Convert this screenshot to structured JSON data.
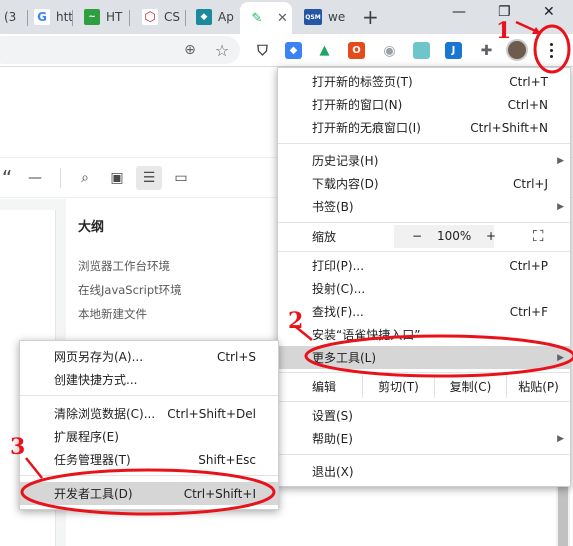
{
  "tabs": [
    {
      "label": "(3",
      "icon": "partial-tab-icon",
      "color": "#ffffff"
    },
    {
      "label": "htt",
      "icon": "google-g-icon",
      "color": "#4285f4"
    },
    {
      "label": "HT",
      "icon": "html-tab-icon",
      "color": "#2e9e3e"
    },
    {
      "label": "CS",
      "icon": "css-tab-icon",
      "color": "#c1272d"
    },
    {
      "label": "Ap",
      "icon": "api-tab-icon",
      "color": "#1a8a9c"
    },
    {
      "label": "",
      "icon": "active-tab-icon",
      "color": "#25b864"
    },
    {
      "label": "we",
      "icon": "qsm-tab-icon",
      "color": "#2456a6",
      "badge": "QSM"
    }
  ],
  "new_tab_symbol": "+",
  "window_controls": {
    "minimize": "—",
    "restore": "❐",
    "close": "✕"
  },
  "extensions": [
    {
      "icon": "shield-ext-icon",
      "glyph": "⛉",
      "color": "#3c4043"
    },
    {
      "icon": "blue-ext-icon",
      "glyph": "◆",
      "color": "#3b82f6"
    },
    {
      "icon": "drive-ext-icon",
      "glyph": "▲",
      "color": "#1fa463"
    },
    {
      "icon": "office-ext-icon",
      "glyph": "O",
      "color": "#e64a19"
    },
    {
      "icon": "camera-ext-icon",
      "glyph": "◉",
      "color": "#9aa0a6"
    },
    {
      "icon": "doc-ext-icon",
      "glyph": "▮",
      "color": "#6ec6ca"
    },
    {
      "icon": "j-ext-icon",
      "glyph": "J",
      "color": "#1976d2"
    },
    {
      "icon": "puzzle-ext-icon",
      "glyph": "✚",
      "color": "#5f6368"
    }
  ],
  "outline": {
    "title": "大纲",
    "items": [
      "浏览器工作台环境",
      "在线JavaScript环境",
      "本地新建文件"
    ]
  },
  "main_menu": {
    "items": [
      {
        "label": "打开新的标签页(T)",
        "shortcut": "Ctrl+T"
      },
      {
        "label": "打开新的窗口(N)",
        "shortcut": "Ctrl+N"
      },
      {
        "label": "打开新的无痕窗口(I)",
        "shortcut": "Ctrl+Shift+N"
      },
      {
        "label": "历史记录(H)",
        "shortcut": "",
        "submenu": true
      },
      {
        "label": "下载内容(D)",
        "shortcut": "Ctrl+J"
      },
      {
        "label": "书签(B)",
        "shortcut": "",
        "submenu": true
      },
      {
        "label": "打印(P)...",
        "shortcut": "Ctrl+P"
      },
      {
        "label": "投射(C)...",
        "shortcut": ""
      },
      {
        "label": "查找(F)...",
        "shortcut": "Ctrl+F"
      },
      {
        "label": "安装“语雀快捷入口”",
        "shortcut": ""
      },
      {
        "label": "更多工具(L)",
        "shortcut": "",
        "submenu": true
      },
      {
        "label": "设置(S)",
        "shortcut": ""
      },
      {
        "label": "帮助(E)",
        "shortcut": "",
        "submenu": true
      },
      {
        "label": "退出(X)",
        "shortcut": ""
      }
    ],
    "zoom": {
      "label": "缩放",
      "minus": "−",
      "value": "100%",
      "plus": "+",
      "fullscreen": "⛶"
    },
    "edit": {
      "label": "编辑",
      "cut": "剪切(T)",
      "copy": "复制(C)",
      "paste": "粘贴(P)"
    }
  },
  "more_tools_menu": {
    "items": [
      {
        "label": "网页另存为(A)...",
        "shortcut": "Ctrl+S"
      },
      {
        "label": "创建快捷方式...",
        "shortcut": ""
      },
      {
        "label": "清除浏览数据(C)...",
        "shortcut": "Ctrl+Shift+Del"
      },
      {
        "label": "扩展程序(E)",
        "shortcut": ""
      },
      {
        "label": "任务管理器(T)",
        "shortcut": "Shift+Esc"
      },
      {
        "label": "开发者工具(D)",
        "shortcut": "Ctrl+Shift+I"
      }
    ]
  },
  "annotations": {
    "step1": "1",
    "step2": "2",
    "step3": "3",
    "color": "#e8121a"
  }
}
